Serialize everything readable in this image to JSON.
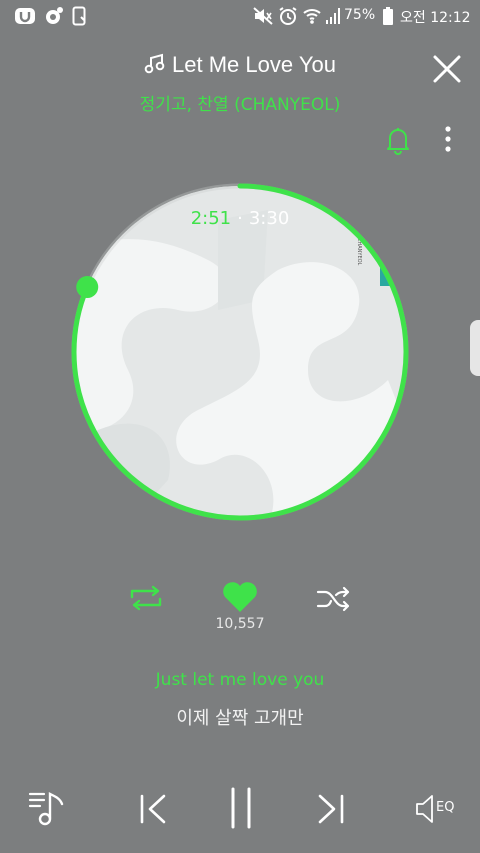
{
  "status_bar": {
    "battery": "75%",
    "time": "오전 12:12",
    "icons": [
      "app-u-icon",
      "music-app-icon",
      "phone-icon",
      "mute-icon",
      "alarm-icon",
      "wifi-icon",
      "signal-icon",
      "battery-icon"
    ]
  },
  "song": {
    "title": "Let Me Love You",
    "artist": "정기고, 찬열 (CHANYEOL)"
  },
  "player": {
    "current_time": "2:51",
    "separator": "·",
    "total_time": "3:30",
    "progress": 0.814,
    "likes": "10,557",
    "lyric_current": "Just let me love you",
    "lyric_next": "이제 살짝 고개만",
    "eq_label": "EQ",
    "album_art_text": "CHANYEOL"
  },
  "colors": {
    "background": "#7c7e7f",
    "accent": "#3fe24a",
    "disc": "#e9ecec"
  }
}
